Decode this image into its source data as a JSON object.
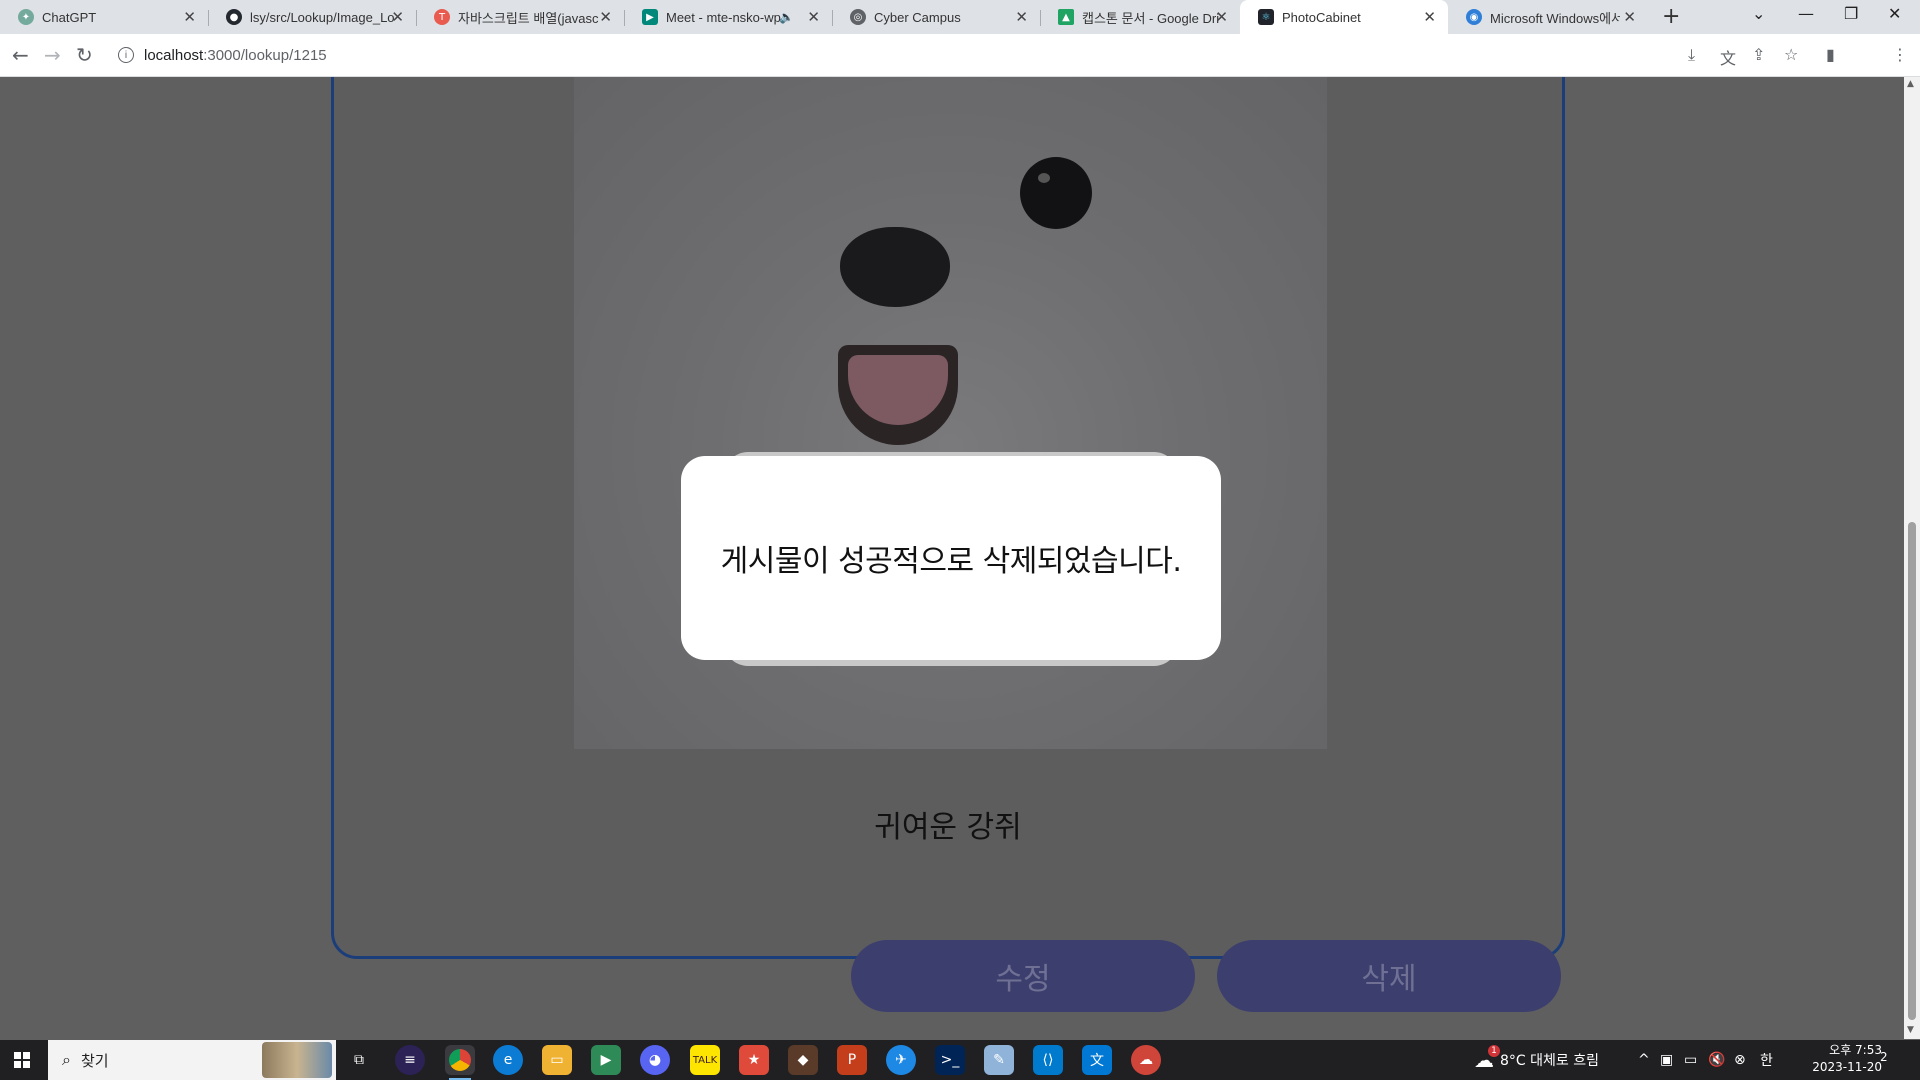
{
  "browser": {
    "tabs": [
      {
        "title": "ChatGPT",
        "icon": "chatgpt-icon",
        "color": "#74aa9c",
        "active": false
      },
      {
        "title": "lsy/src/Lookup/Image_Lo",
        "icon": "github-icon",
        "color": "#24292f",
        "active": false
      },
      {
        "title": "자바스크립트 배열(javasc",
        "icon": "tistory-icon",
        "color": "#e95a4f",
        "active": false
      },
      {
        "title": "Meet - mte-nsko-wp",
        "icon": "google-meet-icon",
        "color": "#00897b",
        "active": false,
        "audio": true
      },
      {
        "title": "Cyber Campus",
        "icon": "globe-icon",
        "color": "#5f6368",
        "active": false
      },
      {
        "title": "캡스톤 문서 - Google Dri",
        "icon": "google-drive-icon",
        "color": "#1fa463",
        "active": false
      },
      {
        "title": "PhotoCabinet",
        "icon": "react-icon",
        "color": "#20232a",
        "active": true
      },
      {
        "title": "Microsoft Windows에서",
        "icon": "microsoft-icon",
        "color": "#2f7fd8",
        "active": false
      }
    ],
    "url_host": "localhost",
    "url_path": ":3000/lookup/1215"
  },
  "page": {
    "photo_alt": "white dog photo",
    "caption": "귀여운 강쥐",
    "edit_button": "수정",
    "delete_button": "삭제"
  },
  "modal": {
    "message": "게시물이 성공적으로 삭제되었습니다."
  },
  "taskbar": {
    "search_placeholder": "찾기",
    "weather": "8°C  대체로 흐림",
    "weather_badge": "1",
    "ime": "한",
    "time": "오후 7:53",
    "date": "2023-11-20",
    "notification_count": "2",
    "apps": [
      {
        "name": "eclipse-icon",
        "color": "#2c2255"
      },
      {
        "name": "chrome-icon",
        "color": "#db4437",
        "running": true
      },
      {
        "name": "edge-icon",
        "color": "#0c7bd4"
      },
      {
        "name": "file-explorer-icon",
        "color": "#f0b232"
      },
      {
        "name": "media-icon",
        "color": "#2e8b57"
      },
      {
        "name": "discord-icon",
        "color": "#5865f2"
      },
      {
        "name": "kakaotalk-icon",
        "color": "#fee500"
      },
      {
        "name": "star-app-icon",
        "color": "#e04a3a"
      },
      {
        "name": "game-icon",
        "color": "#5a3b2a"
      },
      {
        "name": "powerpoint-icon",
        "color": "#c43e1c"
      },
      {
        "name": "bird-app-icon",
        "color": "#1e88e5"
      },
      {
        "name": "powershell-icon",
        "color": "#012456"
      },
      {
        "name": "notes-icon",
        "color": "#8fb3d9"
      },
      {
        "name": "vscode-icon",
        "color": "#007acc"
      },
      {
        "name": "translator-icon",
        "color": "#0078d4"
      },
      {
        "name": "cloud-app-icon",
        "color": "#d0453a"
      }
    ]
  }
}
